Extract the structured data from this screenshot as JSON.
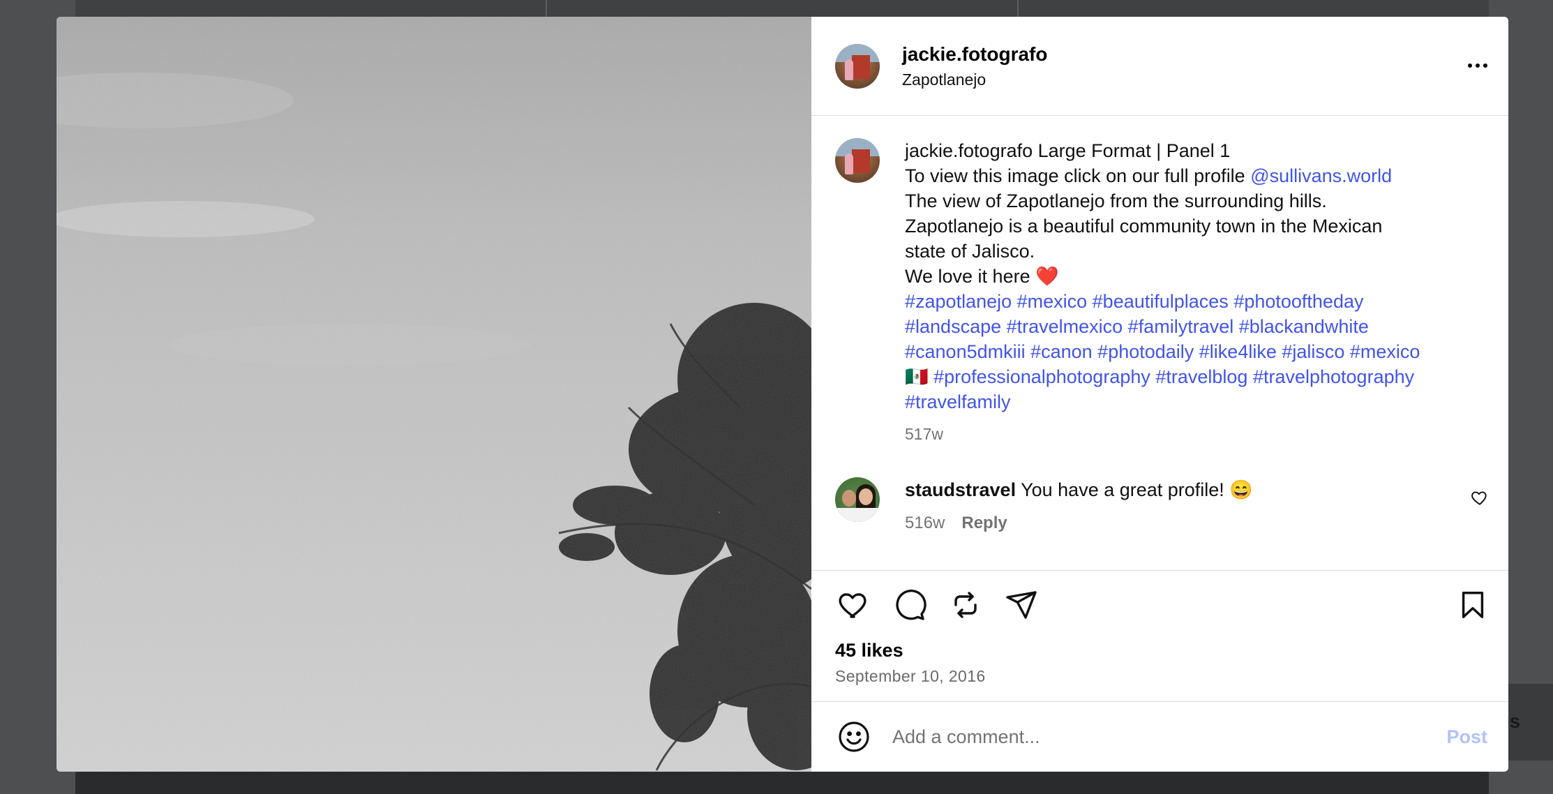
{
  "post": {
    "username": "jackie.fotografo",
    "location": "Zapotlanejo",
    "caption": {
      "username": "jackie.fotografo",
      "title": "Large Format | Panel 1",
      "line2_text": "To view this image click on our full profile ",
      "mention": "@sullivans.world",
      "line3": "The view of Zapotlanejo from the surrounding hills.",
      "line4": "Zapotlanejo is a beautiful community town in the Mexican",
      "line5": "state of Jalisco.",
      "line6": "We love it here ❤️",
      "hashtags_line1": "#zapotlanejo #mexico #beautifulplaces #photooftheday",
      "hashtags_line2": "#landscape #travelmexico #familytravel #blackandwhite",
      "hashtags_line3": "#canon5dmkiii #canon #photodaily #like4like #jalisco #mexico",
      "flag": "🇲🇽",
      "hashtags_line4": "#professionalphotography #travelblog #travelphotography",
      "hashtags_line5": "#travelfamily",
      "time": "517w"
    },
    "comments": [
      {
        "username": "staudstravel",
        "text": "You have a great profile! 😄",
        "time": "516w",
        "reply_label": "Reply"
      }
    ],
    "likes": "45 likes",
    "date": "September 10, 2016",
    "comment_placeholder": "Add a comment...",
    "post_label": "Post"
  },
  "background": {
    "toast_text": "es"
  },
  "colors": {
    "link": "#4154e8",
    "post_button": "#b2c3f8",
    "muted": "#737373"
  },
  "icons": [
    "more-options-icon",
    "like-icon",
    "comment-icon",
    "repost-icon",
    "share-icon",
    "bookmark-icon",
    "emoji-icon",
    "comment-like-icon"
  ]
}
